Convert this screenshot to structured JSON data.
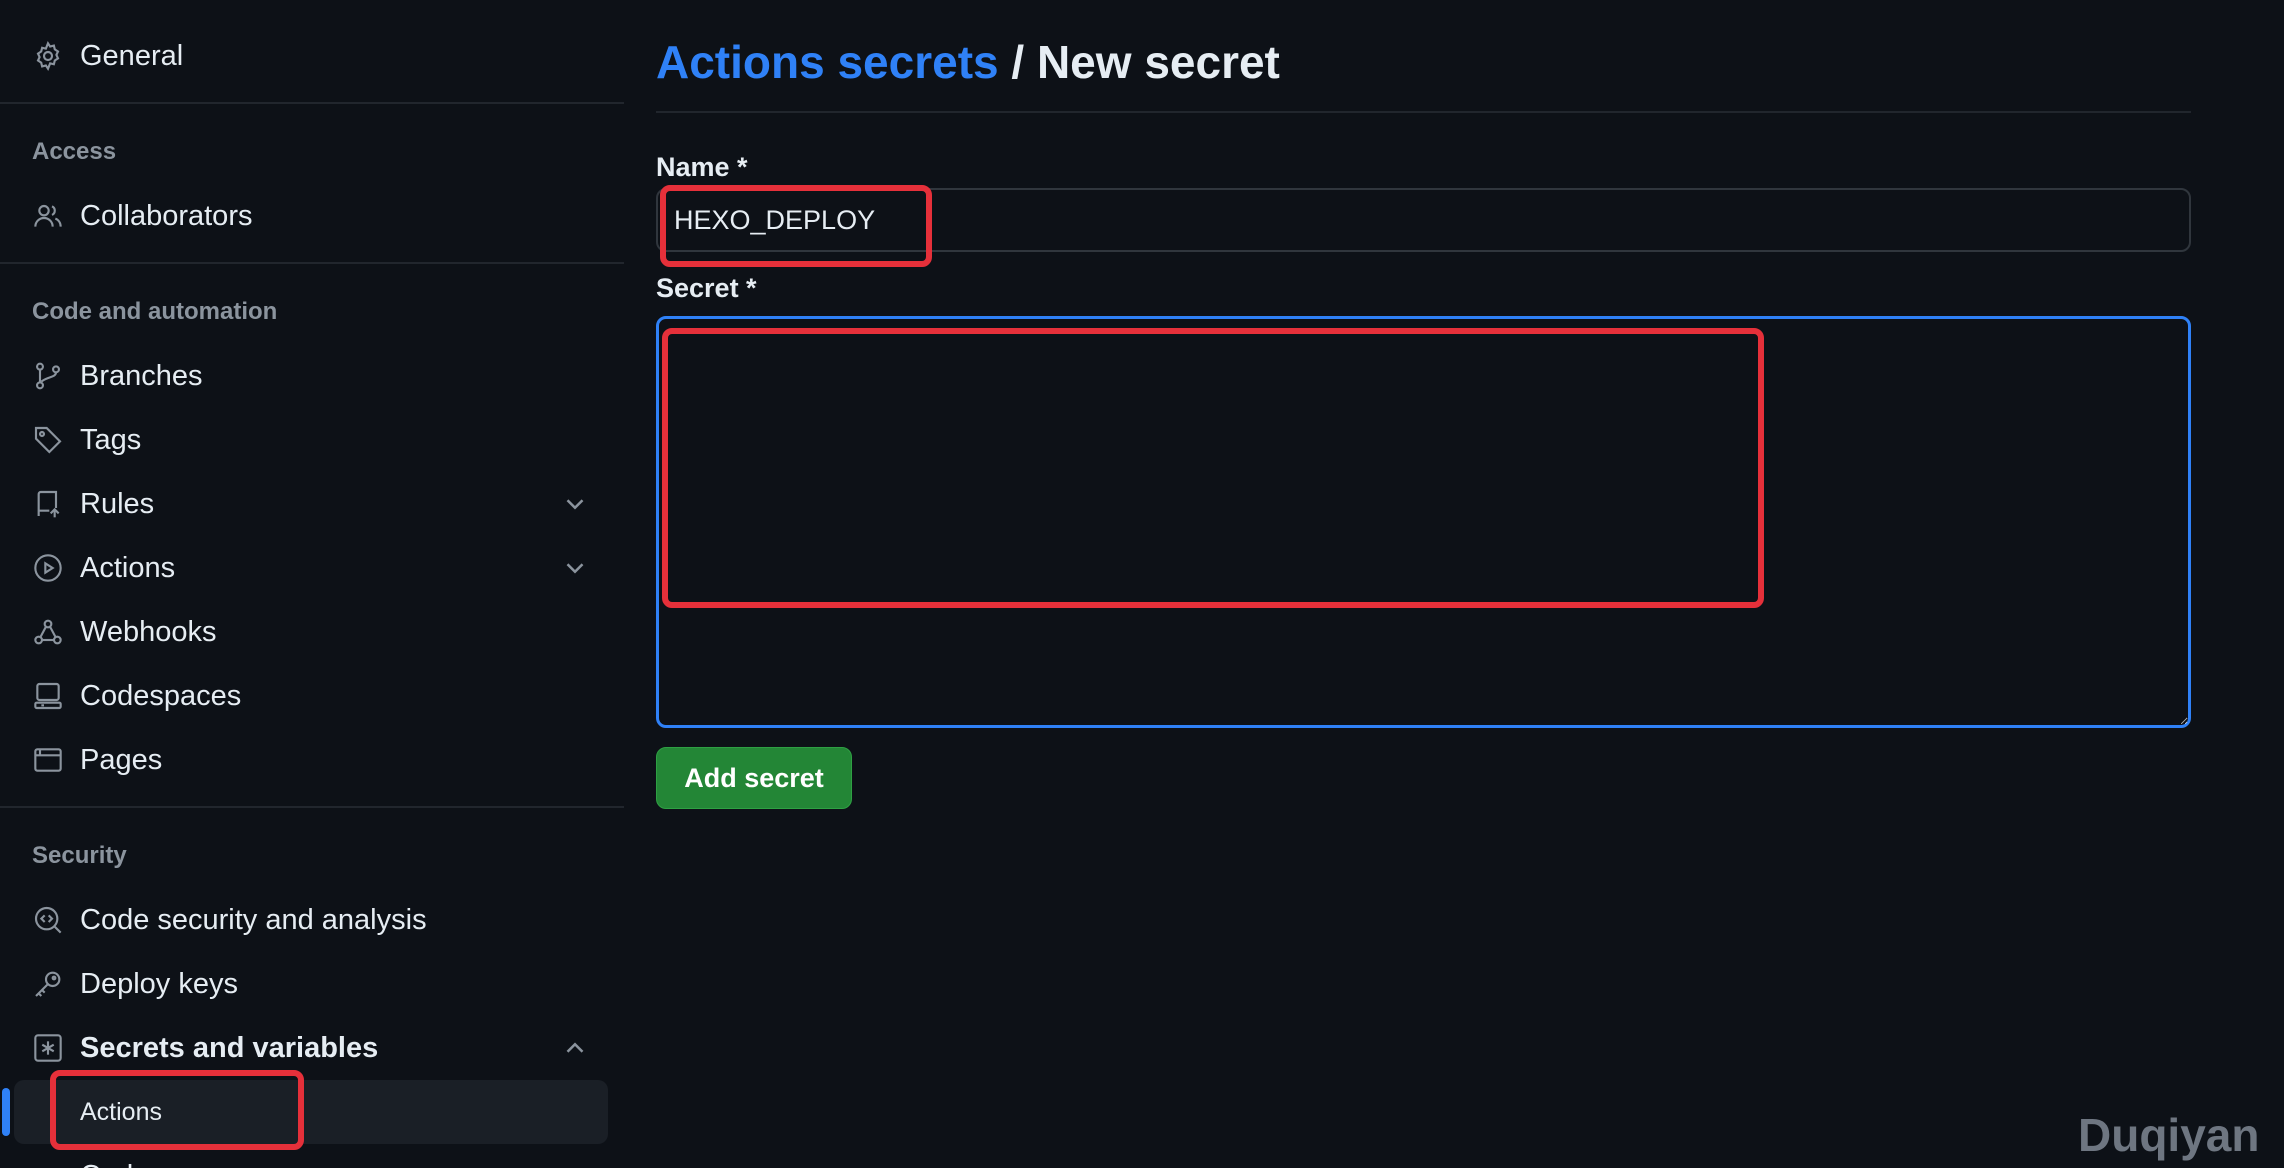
{
  "sidebar": {
    "general": "General",
    "sections": {
      "access": "Access",
      "code_automation": "Code and automation",
      "security": "Security"
    },
    "items": {
      "collaborators": "Collaborators",
      "branches": "Branches",
      "tags": "Tags",
      "rules": "Rules",
      "actions": "Actions",
      "webhooks": "Webhooks",
      "codespaces": "Codespaces",
      "pages": "Pages",
      "code_security": "Code security and analysis",
      "deploy_keys": "Deploy keys",
      "secrets_variables": "Secrets and variables"
    },
    "subnav_active": "Actions",
    "subnav_next_partial": "Codespaces"
  },
  "main": {
    "breadcrumb_link": "Actions secrets",
    "breadcrumb_sep": " / ",
    "breadcrumb_current": "New secret",
    "name_label": "Name *",
    "name_value": "HEXO_DEPLOY",
    "secret_label": "Secret *",
    "secret_value": "",
    "add_button": "Add secret"
  },
  "watermark": "Duqiyan",
  "colors": {
    "background": "#0d1117",
    "link": "#2f81f7",
    "button": "#238636",
    "annotation": "#e5303a",
    "muted": "#8b949e"
  }
}
